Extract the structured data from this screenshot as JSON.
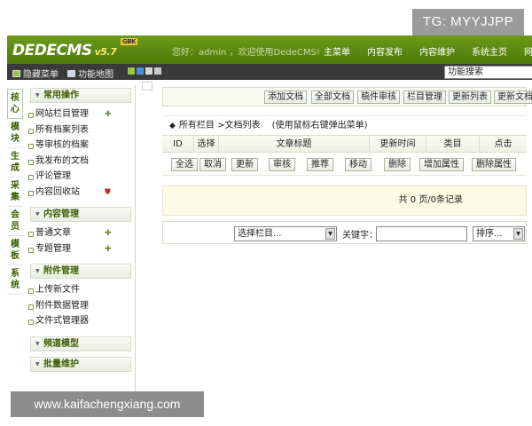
{
  "watermark_top": "TG: MYYJJPP",
  "watermark_bottom": "www.kaifachengxiang.com",
  "header": {
    "logo": "DEDECMS",
    "version": "v5.7",
    "badge": "GBK",
    "welcome": "您好：admin ，欢迎使用DedeCMS!",
    "nav": [
      "主菜单",
      "内容发布",
      "内容维护",
      "系统主页",
      "网站"
    ]
  },
  "toolbar": {
    "hide_menu": "隐藏菜单",
    "func_map": "功能地图",
    "search_placeholder": "功能搜索",
    "colors": [
      "#9bc34b",
      "#4a90d9",
      "#d9d9d9",
      "#cccccc"
    ]
  },
  "vtabs": [
    "核心",
    "模块",
    "生成",
    "采集",
    "会员",
    "模板",
    "系统"
  ],
  "sidebar": {
    "sections": [
      {
        "title": "常用操作",
        "items": [
          "网站栏目管理",
          "所有档案列表",
          "等审核的档案",
          "我发布的文档",
          "评论管理",
          "内容回收站"
        ]
      },
      {
        "title": "内容管理",
        "items": [
          "普通文章",
          "专题管理"
        ]
      },
      {
        "title": "附件管理",
        "items": [
          "上传新文件",
          "附件数据管理",
          "文件式管理器"
        ]
      },
      {
        "title": "频道模型",
        "items": []
      },
      {
        "title": "批量维护",
        "items": []
      }
    ]
  },
  "main": {
    "top_buttons": [
      "添加文档",
      "全部文档",
      "稿件审核",
      "栏目管理",
      "更新列表",
      "更新文档"
    ],
    "list_title": "所有栏目 >文档列表",
    "list_hint": "(使用鼠标右键弹出菜单)",
    "columns": [
      "ID",
      "选择",
      "文章标题",
      "更新时间",
      "类目",
      "点击"
    ],
    "actions": [
      "全选",
      "取消",
      "更新",
      "审核",
      "推荐",
      "移动",
      "删除",
      "增加属性",
      "删除属性"
    ],
    "pagination": "共 0 页/0条记录",
    "filter": {
      "category": "选择栏目...",
      "keyword_label": "关键字：",
      "sort": "排序..."
    }
  }
}
